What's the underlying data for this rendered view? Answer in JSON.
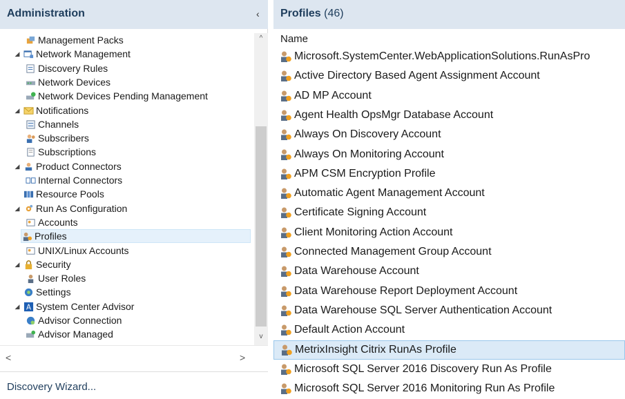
{
  "left_pane": {
    "title": "Administration",
    "collapse_glyph": "‹",
    "tree": [
      {
        "label": "Management Packs",
        "icon": "management-packs-icon",
        "depth": 1,
        "expander": ""
      },
      {
        "label": "Network Management",
        "icon": "network-management-icon",
        "depth": 0,
        "expander": "◢"
      },
      {
        "label": "Discovery Rules",
        "icon": "discovery-rules-icon",
        "depth": 1,
        "expander": ""
      },
      {
        "label": "Network Devices",
        "icon": "network-devices-icon",
        "depth": 1,
        "expander": ""
      },
      {
        "label": "Network Devices Pending Management",
        "icon": "network-pending-icon",
        "depth": 1,
        "expander": ""
      },
      {
        "label": "Notifications",
        "icon": "notifications-icon",
        "depth": 0,
        "expander": "◢"
      },
      {
        "label": "Channels",
        "icon": "channels-icon",
        "depth": 1,
        "expander": ""
      },
      {
        "label": "Subscribers",
        "icon": "subscribers-icon",
        "depth": 1,
        "expander": ""
      },
      {
        "label": "Subscriptions",
        "icon": "subscriptions-icon",
        "depth": 1,
        "expander": ""
      },
      {
        "label": "Product Connectors",
        "icon": "product-connectors-icon",
        "depth": 0,
        "expander": "◢"
      },
      {
        "label": "Internal Connectors",
        "icon": "internal-connectors-icon",
        "depth": 1,
        "expander": ""
      },
      {
        "label": "Resource Pools",
        "icon": "resource-pools-icon",
        "depth": 0,
        "expander": ""
      },
      {
        "label": "Run As Configuration",
        "icon": "run-as-configuration-icon",
        "depth": 0,
        "expander": "◢"
      },
      {
        "label": "Accounts",
        "icon": "accounts-icon",
        "depth": 1,
        "expander": ""
      },
      {
        "label": "Profiles",
        "icon": "profiles-icon",
        "depth": 1,
        "expander": "",
        "selected": true
      },
      {
        "label": "UNIX/Linux Accounts",
        "icon": "unix-linux-accounts-icon",
        "depth": 1,
        "expander": ""
      },
      {
        "label": "Security",
        "icon": "security-icon",
        "depth": 0,
        "expander": "◢"
      },
      {
        "label": "User Roles",
        "icon": "user-roles-icon",
        "depth": 1,
        "expander": ""
      },
      {
        "label": "Settings",
        "icon": "settings-icon",
        "depth": 0,
        "expander": ""
      },
      {
        "label": "System Center Advisor",
        "icon": "system-center-advisor-icon",
        "depth": 0,
        "expander": "◢"
      },
      {
        "label": "Advisor Connection",
        "icon": "advisor-connection-icon",
        "depth": 1,
        "expander": ""
      },
      {
        "label": "Advisor Managed",
        "icon": "advisor-managed-icon",
        "depth": 1,
        "expander": ""
      }
    ],
    "scroll_up": "^",
    "scroll_down": "v",
    "scroll_left": "<",
    "scroll_right": ">",
    "footer_link": "Discovery Wizard..."
  },
  "right_pane": {
    "title": "Profiles",
    "count": "(46)",
    "column_header": "Name",
    "rows": [
      {
        "label": "Microsoft.SystemCenter.WebApplicationSolutions.RunAsPro"
      },
      {
        "label": "Active Directory Based Agent Assignment Account"
      },
      {
        "label": "AD MP Account"
      },
      {
        "label": "Agent Health OpsMgr Database Account"
      },
      {
        "label": "Always On Discovery Account"
      },
      {
        "label": "Always On Monitoring Account"
      },
      {
        "label": "APM CSM Encryption Profile"
      },
      {
        "label": "Automatic Agent Management Account"
      },
      {
        "label": "Certificate Signing Account"
      },
      {
        "label": "Client Monitoring Action Account"
      },
      {
        "label": "Connected Management Group Account"
      },
      {
        "label": "Data Warehouse Account"
      },
      {
        "label": "Data Warehouse Report Deployment Account"
      },
      {
        "label": "Data Warehouse SQL Server Authentication Account"
      },
      {
        "label": "Default Action Account"
      },
      {
        "label": "MetrixInsight Citrix RunAs Profile",
        "selected": true
      },
      {
        "label": "Microsoft SQL Server 2016 Discovery Run As Profile"
      },
      {
        "label": "Microsoft SQL Server 2016 Monitoring Run As Profile"
      }
    ],
    "row_icon": "profile-icon"
  },
  "colors": {
    "header_bg": "#dde6f0",
    "header_text": "#1e3d5c",
    "selection_bg": "#dbeaf7",
    "selection_border": "#99c7eb"
  }
}
